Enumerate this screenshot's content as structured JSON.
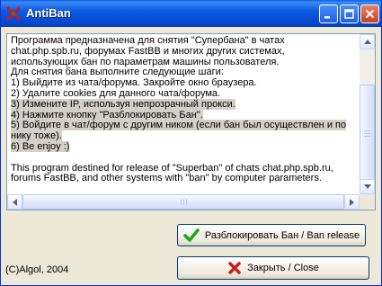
{
  "window": {
    "title": "AntiBan",
    "controls": {
      "minimize": "minimize-icon",
      "maximize": "maximize-icon",
      "close": "close-icon"
    }
  },
  "textbox": {
    "lines": [
      "Программа предназначена для снятия \"Супербана\" в чатах",
      "chat.php.spb.ru, форумах FastBB и многих других системах,",
      "использующих бан по параметрам машины пользователя.",
      "Для снятия бана выполните следующие шаги:",
      "1) Выйдите из чата/форума. Закройте окно браузера.",
      "2) Удалите cookies для данного чата/форума.",
      "3) Измените IP, используя непрозрачный прокси.",
      "4) Нажмите кнопку \"Разблокировать Бан\".",
      "5) Войдите в чат/форум с другим ником (если бан был осуществлен и по",
      "нику тоже).",
      "6) Be enjoy :)",
      "",
      "This program destined for release of \"Superban\" of chats chat.php.spb.ru,",
      "forums FastBB, and other systems with \"ban\" by computer parameters."
    ]
  },
  "buttons": {
    "release": "Разблокировать Бан / Ban release",
    "close": "Закрыть / Close"
  },
  "footer": {
    "copyright": "(C)Algol, 2004"
  },
  "colors": {
    "titlebar": "#0a5ae0",
    "release_icon": "#1aa51a",
    "close_icon": "#c81e1e"
  }
}
